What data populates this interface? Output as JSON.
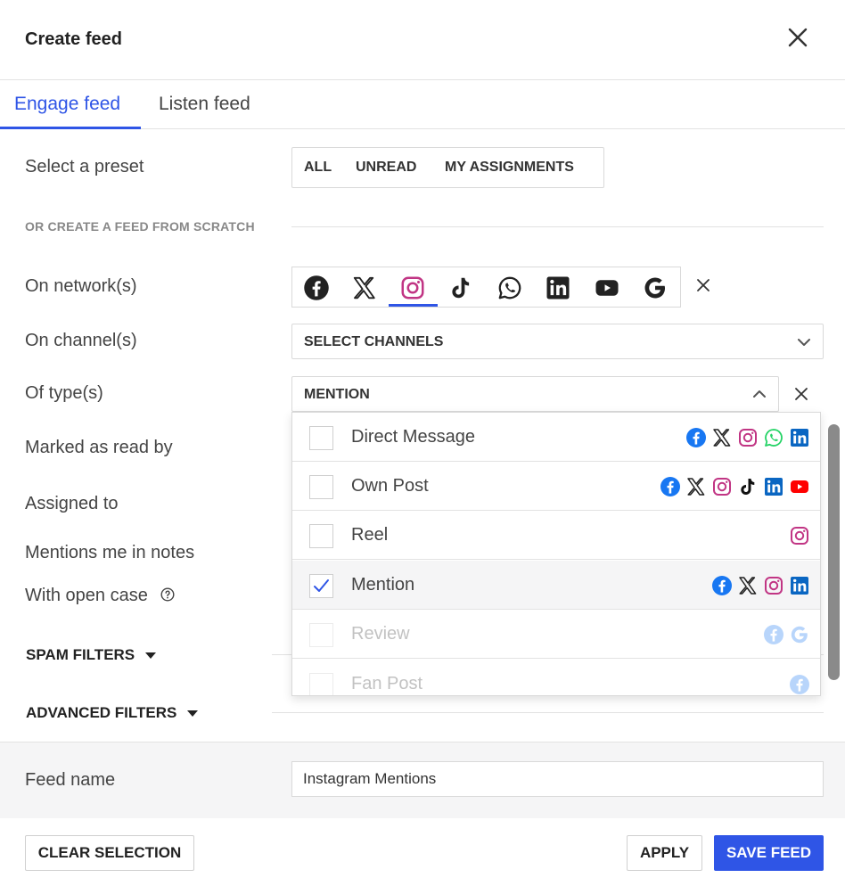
{
  "header": {
    "title": "Create feed"
  },
  "tabs": [
    {
      "label": "Engage feed",
      "active": true
    },
    {
      "label": "Listen feed",
      "active": false
    }
  ],
  "labels": {
    "preset": "Select a preset",
    "scratch": "OR CREATE A FEED FROM SCRATCH",
    "networks": "On network(s)",
    "channels": "On channel(s)",
    "types": "Of type(s)",
    "marked_read": "Marked as read by",
    "assigned": "Assigned to",
    "mentions_notes": "Mentions me in notes",
    "open_case": "With open case",
    "feed_name": "Feed name"
  },
  "presets": [
    "ALL",
    "UNREAD",
    "MY ASSIGNMENTS"
  ],
  "networks": {
    "icons": [
      "facebook-icon",
      "x-icon",
      "instagram-icon",
      "tiktok-icon",
      "whatsapp-icon",
      "linkedin-icon",
      "youtube-icon",
      "google-icon"
    ],
    "selected": "instagram-icon"
  },
  "channels": {
    "value": "SELECT CHANNELS"
  },
  "types": {
    "value": "MENTION",
    "options": [
      {
        "label": "Direct Message",
        "checked": false,
        "disabled": false,
        "icons": [
          "facebook",
          "x",
          "instagram",
          "whatsapp",
          "linkedin"
        ]
      },
      {
        "label": "Own Post",
        "checked": false,
        "disabled": false,
        "icons": [
          "facebook",
          "x",
          "instagram",
          "tiktok",
          "linkedin",
          "youtube"
        ]
      },
      {
        "label": "Reel",
        "checked": false,
        "disabled": false,
        "icons": [
          "instagram"
        ]
      },
      {
        "label": "Mention",
        "checked": true,
        "disabled": false,
        "icons": [
          "facebook",
          "x",
          "instagram",
          "linkedin"
        ]
      },
      {
        "label": "Review",
        "checked": false,
        "disabled": true,
        "icons": [
          "facebook",
          "google"
        ]
      },
      {
        "label": "Fan Post",
        "checked": false,
        "disabled": true,
        "icons": [
          "facebook"
        ]
      }
    ]
  },
  "filters": {
    "spam": "SPAM FILTERS",
    "advanced": "ADVANCED FILTERS"
  },
  "feed_name": {
    "value": "Instagram Mentions"
  },
  "buttons": {
    "clear": "CLEAR SELECTION",
    "apply": "APPLY",
    "save": "SAVE FEED"
  },
  "colors": {
    "accent": "#2f55e6",
    "facebook": "#1877f2",
    "instagram": "#c13584",
    "whatsapp": "#25d366",
    "linkedin": "#0a66c2",
    "youtube": "#ff0000"
  }
}
